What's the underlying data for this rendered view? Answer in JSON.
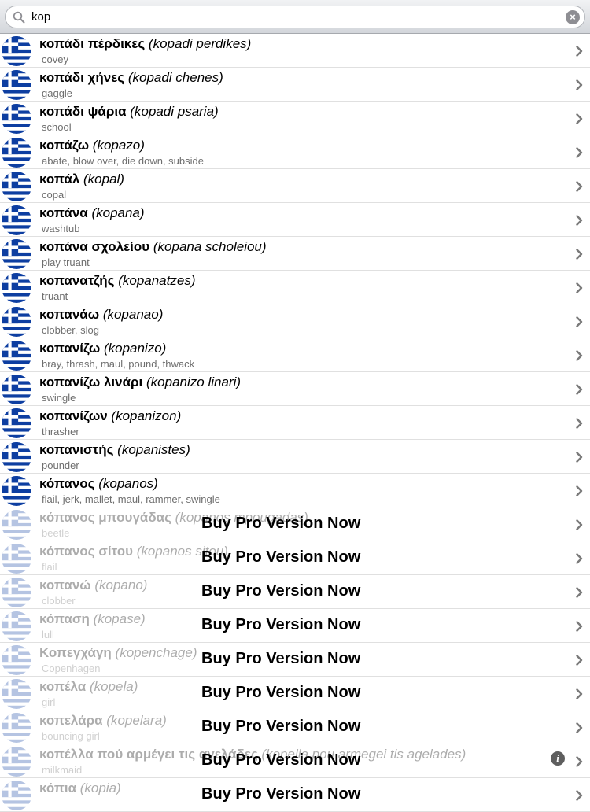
{
  "search": {
    "value": "kop",
    "placeholder": ""
  },
  "pro_label": "Buy Pro Version Now",
  "entries": [
    {
      "greek": "κοπάδι πέρδικες",
      "translit": "(kopadi perdikes)",
      "english": "covey",
      "locked": false
    },
    {
      "greek": "κοπάδι χήνες",
      "translit": "(kopadi chenes)",
      "english": "gaggle",
      "locked": false
    },
    {
      "greek": "κοπάδι ψάρια",
      "translit": "(kopadi psaria)",
      "english": "school",
      "locked": false
    },
    {
      "greek": "κοπάζω",
      "translit": "(kopazo)",
      "english": "abate, blow over, die down, subside",
      "locked": false
    },
    {
      "greek": "κοπάλ",
      "translit": "(kopal)",
      "english": "copal",
      "locked": false
    },
    {
      "greek": "κοπάνα",
      "translit": "(kopana)",
      "english": "washtub",
      "locked": false
    },
    {
      "greek": "κοπάνα σχολείου",
      "translit": "(kopana scholeiou)",
      "english": "play truant",
      "locked": false
    },
    {
      "greek": "κοπανατζής",
      "translit": "(kopanatzes)",
      "english": "truant",
      "locked": false
    },
    {
      "greek": "κοπανάω",
      "translit": "(kopanao)",
      "english": "clobber, slog",
      "locked": false
    },
    {
      "greek": "κοπανίζω",
      "translit": "(kopanizo)",
      "english": "bray, thrash, maul, pound, thwack",
      "locked": false
    },
    {
      "greek": "κοπανίζω λινάρι",
      "translit": "(kopanizo linari)",
      "english": "swingle",
      "locked": false
    },
    {
      "greek": "κοπανίζων",
      "translit": "(kopanizon)",
      "english": "thrasher",
      "locked": false
    },
    {
      "greek": "κοπανιστής",
      "translit": "(kopanistes)",
      "english": "pounder",
      "locked": false
    },
    {
      "greek": "κόπανος",
      "translit": "(kopanos)",
      "english": "flail, jerk, mallet, maul, rammer, swingle",
      "locked": false
    },
    {
      "greek": "κόπανος μπουγάδας",
      "translit": "(kopanos mpougadas)",
      "english": "beetle",
      "locked": true
    },
    {
      "greek": "κόπανος σίτου",
      "translit": "(kopanos sitou)",
      "english": "flail",
      "locked": true
    },
    {
      "greek": "κοπανώ",
      "translit": "(kopano)",
      "english": "clobber",
      "locked": true
    },
    {
      "greek": "κόπαση",
      "translit": "(kopase)",
      "english": "lull",
      "locked": true
    },
    {
      "greek": "Κοπεγχάγη",
      "translit": "(kopenchage)",
      "english": "Copenhagen",
      "locked": true
    },
    {
      "greek": "κοπέλα",
      "translit": "(kopela)",
      "english": "girl",
      "locked": true
    },
    {
      "greek": "κοπελάρα",
      "translit": "(kopelara)",
      "english": "bouncing girl",
      "locked": true
    },
    {
      "greek": "κοπέλλα πού αρμέγει τις αγελάδες",
      "translit": "(kopella pou armegei tis agelades)",
      "english": "milkmaid",
      "locked": true,
      "info": "i"
    },
    {
      "greek": "κόπια",
      "translit": "(kopia)",
      "english": "",
      "locked": true
    }
  ],
  "colors": {
    "flag_blue": "#0d3ea1",
    "flag_white": "#ffffff",
    "chevron": "#7a7a7a"
  },
  "icons": {
    "search": "magnifier-icon",
    "clear": "clear-icon",
    "chevron": "chevron-right-icon",
    "info": "info-icon",
    "flag": "greek-flag-icon"
  }
}
